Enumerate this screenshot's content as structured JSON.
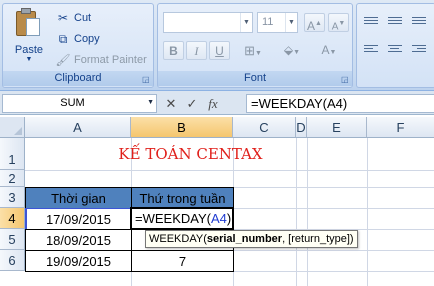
{
  "ribbon": {
    "clipboard": {
      "label": "Clipboard",
      "paste": "Paste",
      "cut": "Cut",
      "copy": "Copy",
      "format_painter": "Format Painter"
    },
    "font": {
      "label": "Font",
      "font_name": "",
      "font_size": "11",
      "bold": "B",
      "italic": "I",
      "underline": "U",
      "grow": "A",
      "shrink": "A"
    }
  },
  "formula_bar": {
    "name_box": "SUM",
    "cancel_glyph": "✕",
    "enter_glyph": "✓",
    "fx": "fx",
    "formula": "=WEEKDAY(A4)"
  },
  "grid": {
    "columns": [
      "A",
      "B",
      "C",
      "D",
      "E",
      "F"
    ],
    "rows": [
      "1",
      "2",
      "3",
      "4",
      "5",
      "6"
    ],
    "title": "KẾ TOÁN CENTAX",
    "header_a": "Thời gian",
    "header_b": "Thứ trong tuần",
    "dates": [
      "17/09/2015",
      "18/09/2015",
      "19/09/2015"
    ],
    "b5": "",
    "b6": "7",
    "active_cell": {
      "prefix": "=WEEKDAY(",
      "ref": "A4",
      "suffix": ")"
    }
  },
  "tooltip": {
    "fn": "WEEKDAY(",
    "arg1": "serial_number",
    "rest": ", [return_type])"
  },
  "colors": {
    "header_fill": "#4f81bd",
    "title_red": "#e0201b",
    "selected_header": "#f5c66e",
    "reference_blue": "#1f3bd1"
  }
}
